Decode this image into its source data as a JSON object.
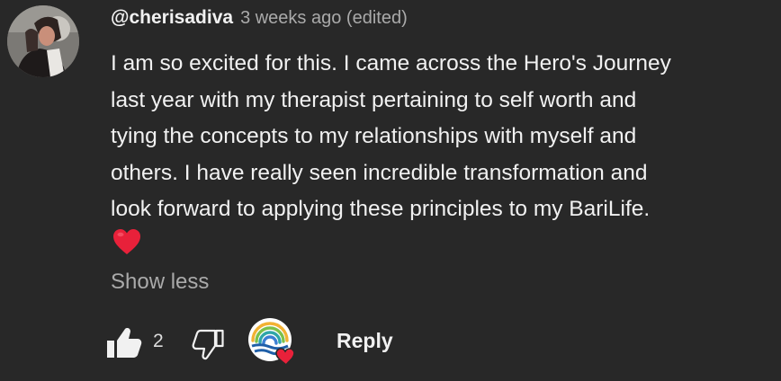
{
  "comment": {
    "author_handle": "@cherisadiva",
    "timestamp": "3 weeks ago (edited)",
    "text_lines": [
      "I am so excited for this.  I came across the Hero's Journey",
      "last year with my therapist pertaining to self worth and",
      "tying the concepts to my relationships with myself and",
      "others.  I have really seen incredible transformation and",
      "look forward to applying these principles to my BariLife."
    ],
    "emoji": "heart-emoji",
    "show_less_label": "Show less"
  },
  "actions": {
    "like_icon": "thumbs-up-filled-icon",
    "like_count": "2",
    "dislike_icon": "thumbs-down-outline-icon",
    "creator_heart_icon": "creator-heart-badge",
    "reply_label": "Reply"
  },
  "colors": {
    "background": "#282828",
    "text_primary": "#f1f1f1",
    "text_secondary": "#aaaaaa",
    "heart_red": "#e8213a"
  }
}
